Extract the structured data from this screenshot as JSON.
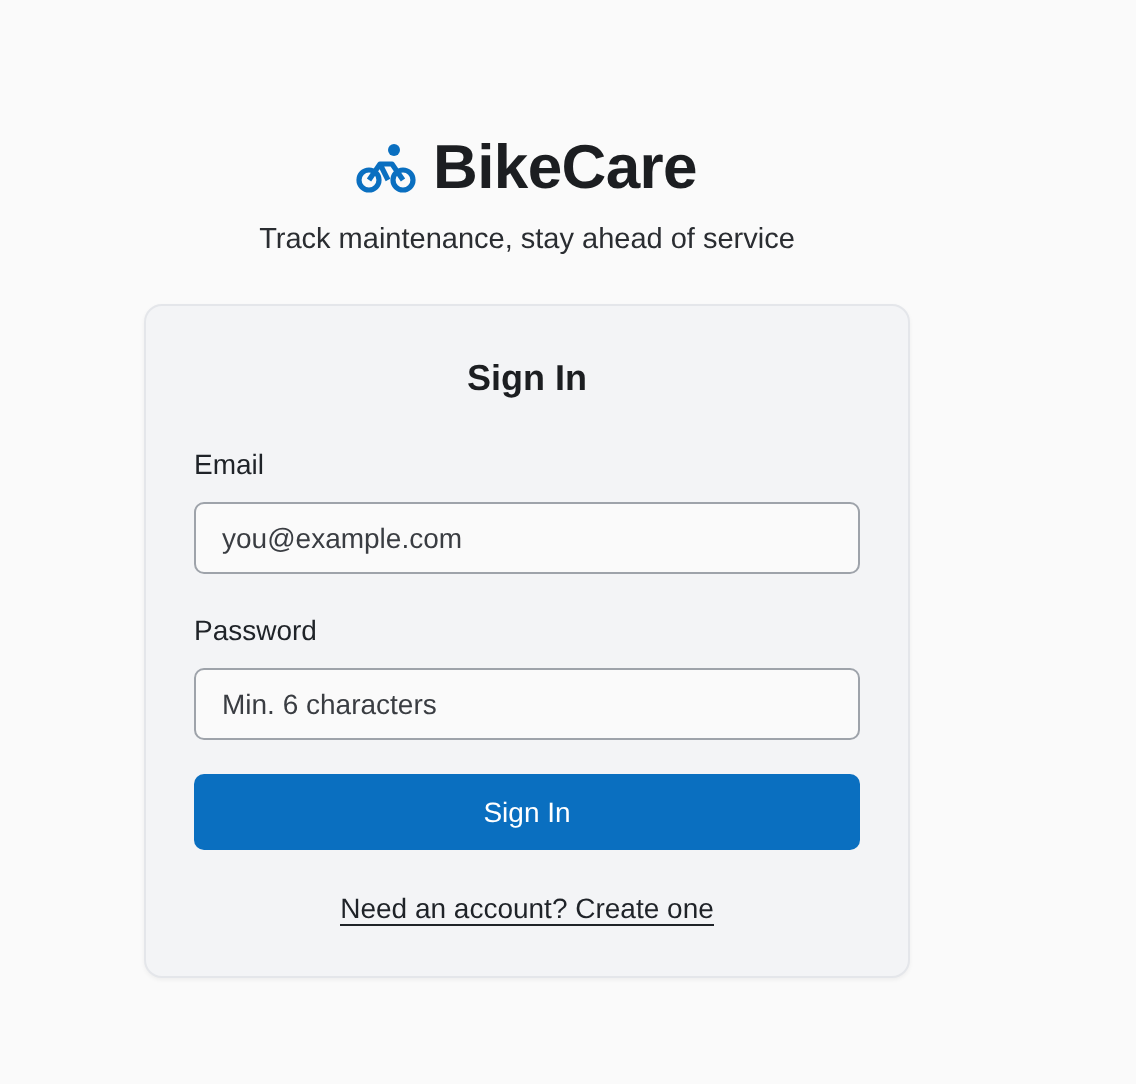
{
  "brand": {
    "name": "BikeCare",
    "tagline": "Track maintenance, stay ahead of service"
  },
  "card": {
    "title": "Sign In",
    "fields": [
      {
        "label": "Email",
        "placeholder": "you@example.com"
      },
      {
        "label": "Password",
        "placeholder": "Min. 6 characters"
      }
    ],
    "submit": "Sign In",
    "link": "Need an account? Create one"
  }
}
